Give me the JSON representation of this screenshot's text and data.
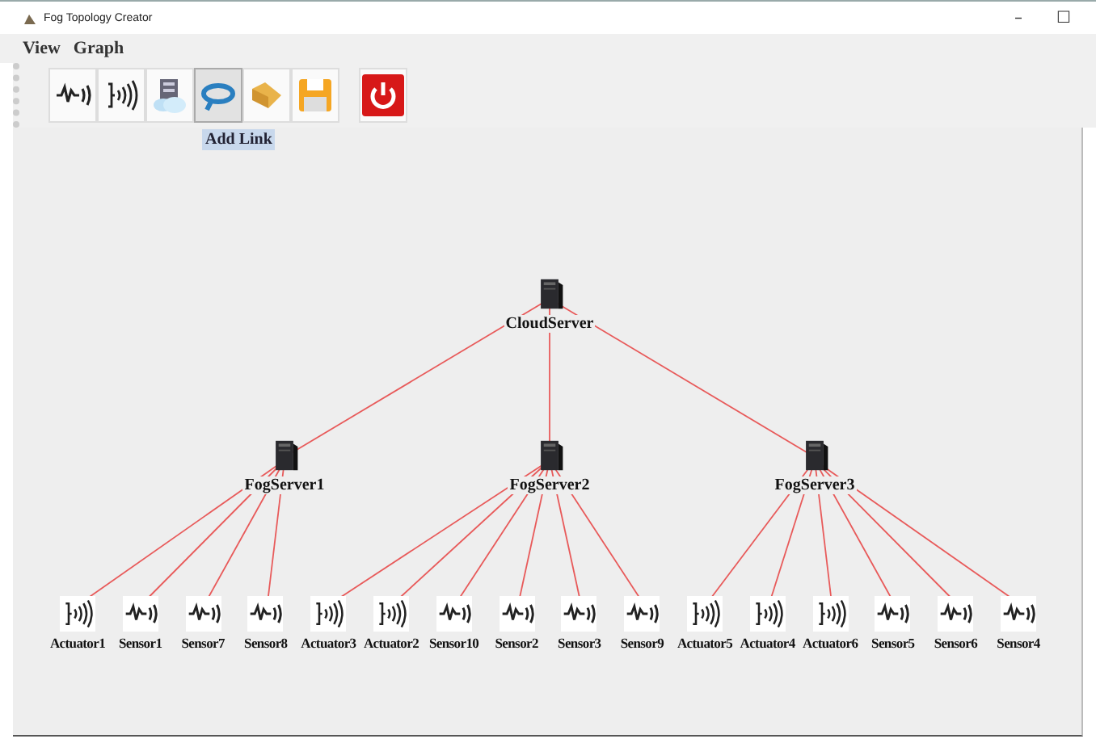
{
  "window": {
    "title": "Fog Topology Creator",
    "controls": [
      "–",
      "☐"
    ]
  },
  "menu": [
    "View",
    "Graph"
  ],
  "toolbar": [
    {
      "kind": "sensor",
      "hovered": false
    },
    {
      "kind": "actuator",
      "hovered": false
    },
    {
      "kind": "server",
      "hovered": false
    },
    {
      "kind": "link",
      "hovered": true
    },
    {
      "kind": "open",
      "hovered": false
    },
    {
      "kind": "save",
      "hovered": false
    },
    {
      "kind": "power",
      "hovered": false
    }
  ],
  "tooltip": "Add Link",
  "topology": {
    "name": "CloudServer",
    "children": [
      {
        "name": "FogServer1",
        "children": [
          {
            "name": "Actuator1",
            "kind": "actuator"
          },
          {
            "name": "Sensor1",
            "kind": "sensor"
          },
          {
            "name": "Sensor7",
            "kind": "sensor"
          },
          {
            "name": "Sensor8",
            "kind": "sensor"
          }
        ]
      },
      {
        "name": "FogServer2",
        "children": [
          {
            "name": "Actuator3",
            "kind": "actuator"
          },
          {
            "name": "Actuator2",
            "kind": "actuator"
          },
          {
            "name": "Sensor10",
            "kind": "sensor"
          },
          {
            "name": "Sensor2",
            "kind": "sensor"
          },
          {
            "name": "Sensor3",
            "kind": "sensor"
          },
          {
            "name": "Sensor9",
            "kind": "sensor"
          }
        ]
      },
      {
        "name": "FogServer3",
        "children": [
          {
            "name": "Actuator5",
            "kind": "actuator"
          },
          {
            "name": "Actuator4",
            "kind": "actuator"
          },
          {
            "name": "Actuator6",
            "kind": "actuator"
          },
          {
            "name": "Sensor5",
            "kind": "sensor"
          },
          {
            "name": "Sensor6",
            "kind": "sensor"
          },
          {
            "name": "Sensor4",
            "kind": "sensor"
          }
        ]
      }
    ]
  }
}
